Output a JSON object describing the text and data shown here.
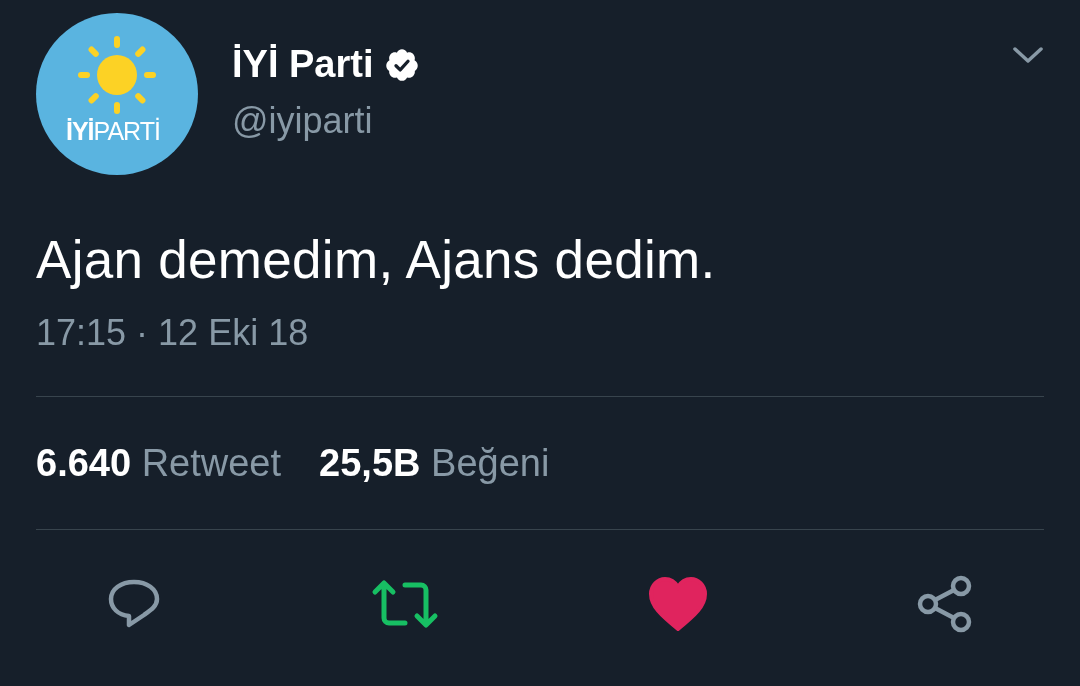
{
  "avatar": {
    "logo_text": "**İYİ**PARTİ"
  },
  "author": {
    "name": "İYİ Parti",
    "verified": true,
    "handle": "@iyiparti"
  },
  "tweet": {
    "text": "Ajan demedim, Ajans dedim.",
    "timestamp": "17:15 · 12 Eki 18"
  },
  "stats": [
    {
      "count": "6.640",
      "label": "Retweet"
    },
    {
      "count": "25,5B",
      "label": "Beğeni"
    }
  ],
  "actions": {
    "retweeted": true,
    "liked": true
  }
}
